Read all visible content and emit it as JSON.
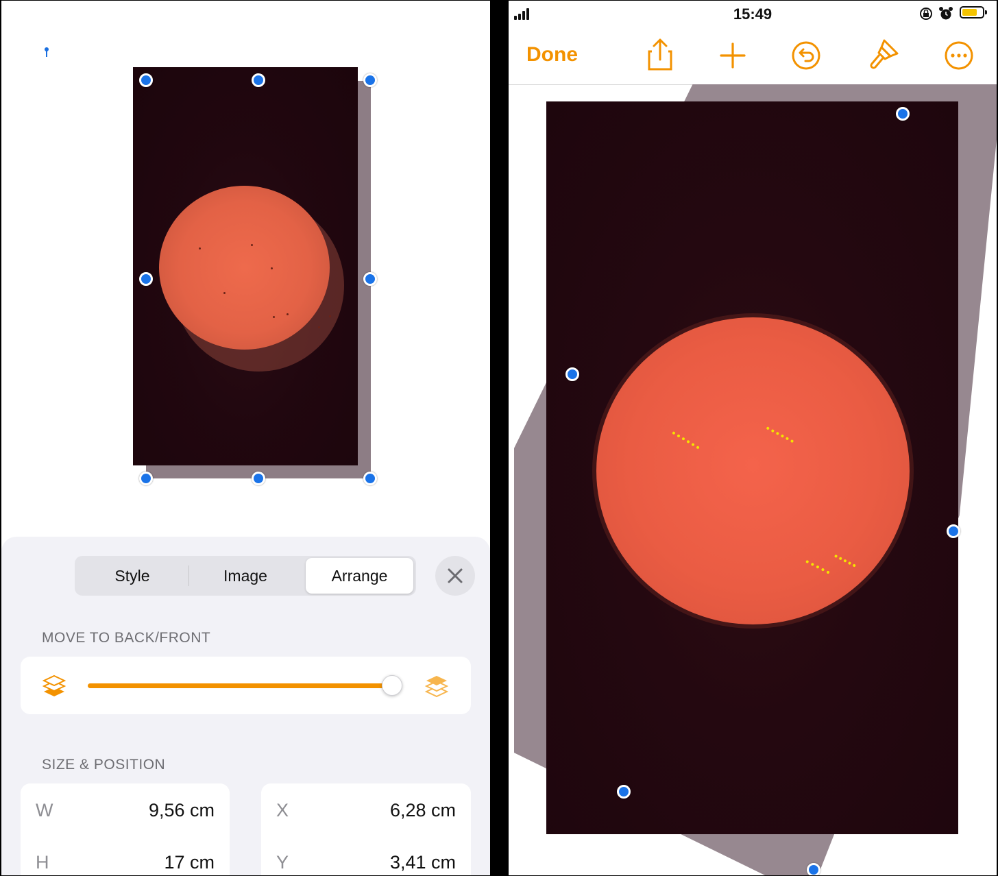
{
  "left_panel": {
    "inspector": {
      "tabs": [
        {
          "label": "Style",
          "active": false
        },
        {
          "label": "Image",
          "active": false
        },
        {
          "label": "Arrange",
          "active": true
        }
      ],
      "close_icon": "close-icon",
      "move_section": {
        "title": "MOVE TO BACK/FRONT",
        "back_icon": "layers-back-icon",
        "front_icon": "layers-front-icon",
        "slider_value": 1.0
      },
      "size_position": {
        "title": "SIZE & POSITION",
        "width": {
          "label": "W",
          "value": "9,56 cm"
        },
        "height": {
          "label": "H",
          "value": "17 cm"
        },
        "x": {
          "label": "X",
          "value": "6,28 cm"
        },
        "y": {
          "label": "Y",
          "value": "3,41 cm"
        }
      }
    }
  },
  "right_panel": {
    "status_bar": {
      "time": "15:49",
      "icons": [
        "signal-icon",
        "orientation-lock-icon",
        "alarm-icon",
        "battery-icon"
      ]
    },
    "toolbar": {
      "done_label": "Done",
      "icons": [
        "share-icon",
        "plus-icon",
        "undo-icon",
        "paintbrush-icon",
        "more-icon"
      ]
    }
  },
  "colors": {
    "accent_orange": "#f39200",
    "handle_blue": "#1a73e8",
    "sun": "#ea5c43",
    "highlight_yellow": "#f5e400"
  }
}
